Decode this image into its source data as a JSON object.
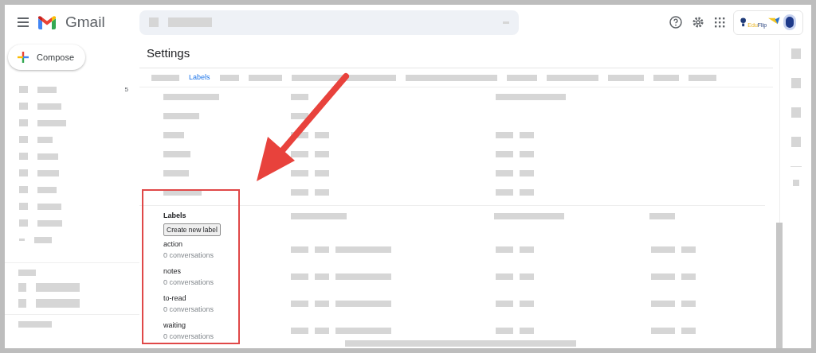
{
  "app": {
    "name": "Gmail"
  },
  "compose": {
    "label": "Compose"
  },
  "sidebar": {
    "badge": "5"
  },
  "logo_text": [
    "Edu",
    "Flip"
  ],
  "page_title": "Settings",
  "tabs": [
    {
      "label": "Labels",
      "selected": true
    }
  ],
  "labels_section": {
    "heading": "Labels",
    "create_button": "Create new label",
    "items": [
      {
        "name": "action",
        "count": "0 conversations"
      },
      {
        "name": "notes",
        "count": "0 conversations"
      },
      {
        "name": "to-read",
        "count": "0 conversations"
      },
      {
        "name": "waiting",
        "count": "0 conversations"
      }
    ]
  }
}
